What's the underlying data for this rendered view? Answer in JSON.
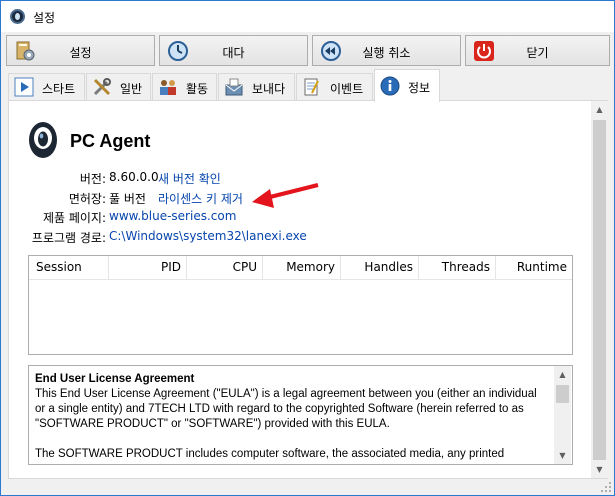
{
  "window": {
    "title": "설정"
  },
  "toolbar": {
    "settings_label": "설정",
    "wait_label": "대다",
    "undo_label": "실행 취소",
    "close_label": "닫기"
  },
  "tabs": [
    {
      "label": "스타트",
      "icon": "play-icon"
    },
    {
      "label": "일반",
      "icon": "tools-icon"
    },
    {
      "label": "활동",
      "icon": "people-icon"
    },
    {
      "label": "보내다",
      "icon": "mail-icon"
    },
    {
      "label": "이벤트",
      "icon": "notepad-icon"
    },
    {
      "label": "정보",
      "icon": "info-icon",
      "active": true
    }
  ],
  "info": {
    "product_name": "PC Agent",
    "version_label": "버전:",
    "version_value": "8.60.0.0",
    "check_update_link": "새 버전 확인",
    "license_label": "면허장:",
    "license_value": "풀 버전",
    "remove_key_link": "라이센스 키 제거",
    "product_page_label": "제품 페이지:",
    "product_page_link": "www.blue-series.com",
    "program_path_label": "프로그램 경로:",
    "program_path_link": "C:\\Windows\\system32\\lanexi.exe"
  },
  "process_table": {
    "columns": [
      "Session",
      "PID",
      "CPU",
      "Memory",
      "Handles",
      "Threads",
      "Runtime"
    ],
    "rows": []
  },
  "eula": {
    "title": "End User License Agreement",
    "paragraph1": "This End User License Agreement (\"EULA\") is a legal agreement between you (either an individual or a single entity) and 7TECH LTD with regard to the copyrighted Software (herein referred to as \"SOFTWARE PRODUCT\" or \"SOFTWARE\") provided with this EULA.",
    "paragraph2": "The SOFTWARE PRODUCT includes computer software, the associated media, any printed"
  },
  "colors": {
    "link": "#0645ad",
    "arrow_annotation": "#e3141b",
    "window_border": "#2b79d0"
  }
}
